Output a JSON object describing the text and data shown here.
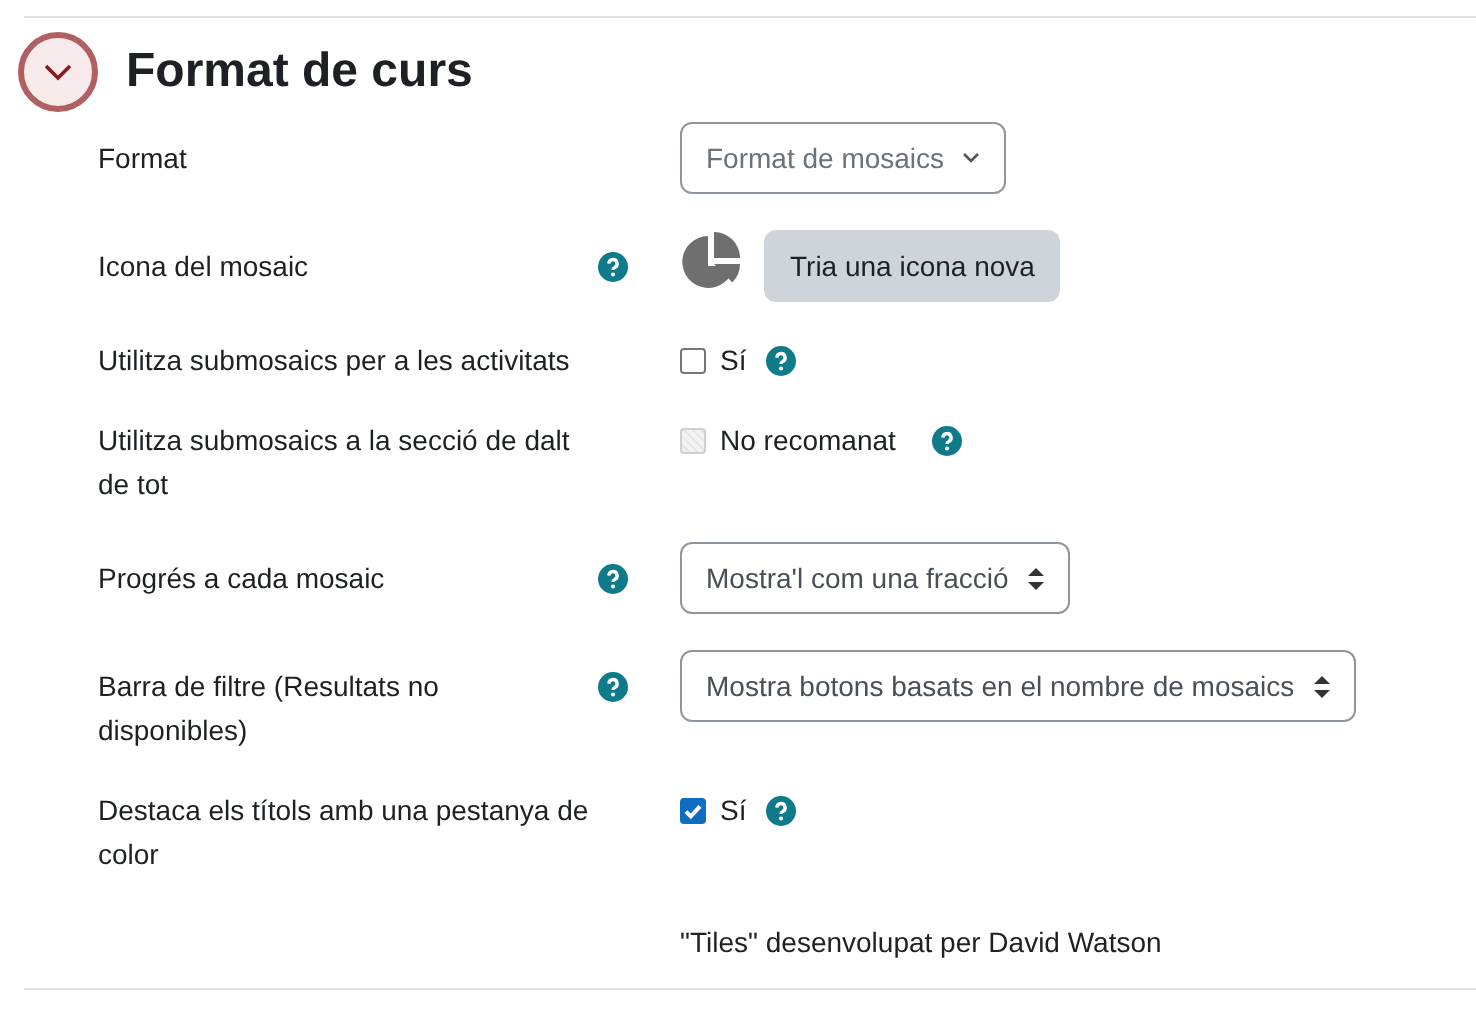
{
  "section": {
    "title": "Format de curs",
    "expanded": true
  },
  "rows": [
    {
      "label": "Format",
      "kind": "dropdown",
      "value": "Format de mosaics",
      "help": false
    },
    {
      "label": "Icona del mosaic",
      "kind": "iconpicker",
      "button": "Tria una icona nova",
      "help": true
    },
    {
      "label": "Utilitza submosaics per a les activitats",
      "kind": "checkbox",
      "text": "Sí",
      "checked": false,
      "disabled": false,
      "help": true
    },
    {
      "label": "Utilitza submosaics a la secció de dalt de tot",
      "kind": "checkbox",
      "text": "No recomanat",
      "checked": false,
      "disabled": true,
      "help": true
    },
    {
      "label": "Progrés a cada mosaic",
      "kind": "select",
      "value": "Mostra'l com una fracció",
      "help": true
    },
    {
      "label": "Barra de filtre (Resultats no disponibles)",
      "kind": "select",
      "value": "Mostra botons basats en el nombre de mosaics",
      "help": true
    },
    {
      "label": "Destaca els títols amb una pestanya de color",
      "kind": "checkbox",
      "text": "Sí",
      "checked": true,
      "disabled": false,
      "help": true
    },
    {
      "kind": "static",
      "text": "\"Tiles\" desenvolupat per David Watson",
      "help": false
    }
  ]
}
